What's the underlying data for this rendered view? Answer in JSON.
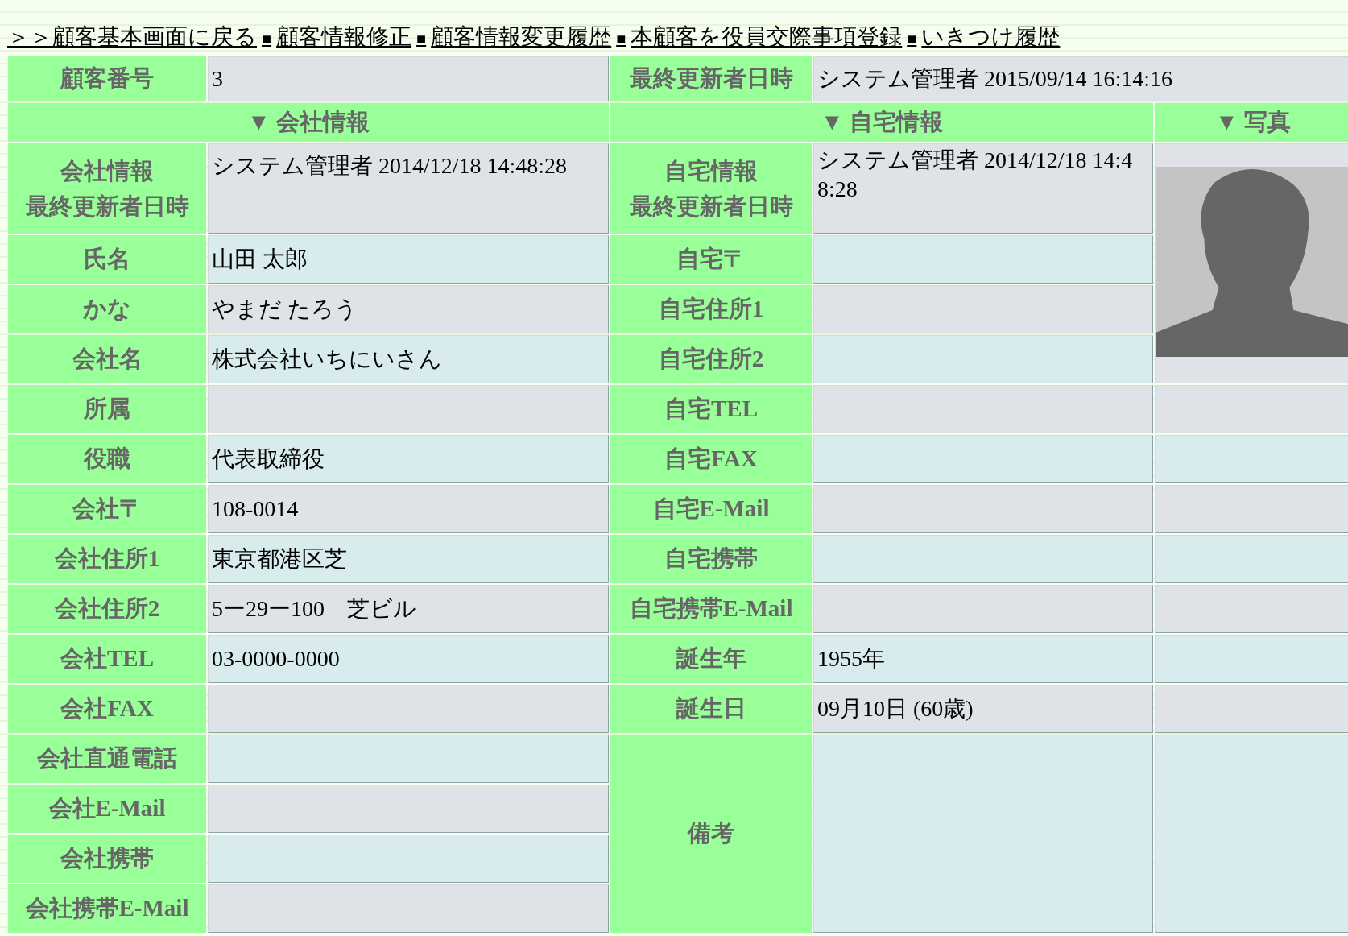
{
  "nav": [
    {
      "kind": "link",
      "text": "＞＞顧客基本画面に戻る"
    },
    {
      "kind": "separator",
      "text": "■"
    },
    {
      "kind": "link",
      "text": "顧客情報修正"
    },
    {
      "kind": "separator",
      "text": "■"
    },
    {
      "kind": "link",
      "text": "顧客情報変更履歴"
    },
    {
      "kind": "separator",
      "text": "■"
    },
    {
      "kind": "link",
      "text": "本顧客を役員交際事項登録"
    },
    {
      "kind": "separator",
      "text": "■"
    },
    {
      "kind": "link",
      "text": "いきつけ履歴"
    }
  ],
  "summary": {
    "customer_no_label": "顧客番号",
    "customer_no": "3",
    "updated_label": "最終更新者日時",
    "updated": "システム管理者 2015/09/14 16:14:16"
  },
  "sections": [
    {
      "title": "▼ 会社情報"
    },
    {
      "title": "▼ 自宅情報"
    },
    {
      "title": "▼ 写真"
    }
  ],
  "company_updated": {
    "label_lines": [
      "会社情報",
      "最終更新者日時"
    ],
    "value": "システム管理者 2014/12/18 14:48:28"
  },
  "home_updated": {
    "label_lines": [
      "自宅情報",
      "最終更新者日時"
    ],
    "value": "システム管理者 2014/12/18 14:48:28"
  },
  "company_fields": [
    {
      "label": "氏名",
      "value": "山田 太郎"
    },
    {
      "label": "かな",
      "value": "やまだ たろう"
    },
    {
      "label": "会社名",
      "value": "株式会社いちにいさん"
    },
    {
      "label": "所属"
    },
    {
      "label": "役職",
      "value": "代表取締役"
    },
    {
      "label": "会社〒",
      "value": "108-0014"
    },
    {
      "label": "会社住所1",
      "value": "東京都港区芝"
    },
    {
      "label": "会社住所2",
      "value": "5ー29ー100　芝ビル"
    },
    {
      "label": "会社TEL",
      "value": "03-0000-0000"
    },
    {
      "label": "会社FAX"
    },
    {
      "label": "会社直通電話"
    },
    {
      "label": "会社E-Mail"
    },
    {
      "label": "会社携帯"
    },
    {
      "label": "会社携帯E-Mail"
    }
  ],
  "home_fields": [
    {
      "label": "自宅〒"
    },
    {
      "label": "自宅住所1"
    },
    {
      "label": "自宅住所2"
    },
    {
      "label": "自宅TEL"
    },
    {
      "label": "自宅FAX"
    },
    {
      "label": "自宅E-Mail"
    },
    {
      "label": "自宅携帯"
    },
    {
      "label": "自宅携帯E-Mail"
    },
    {
      "label": "誕生年",
      "value": "1955年"
    },
    {
      "label": "誕生日",
      "value": "09月10日 (60歳)"
    }
  ],
  "remarks": {
    "label": "備考"
  }
}
